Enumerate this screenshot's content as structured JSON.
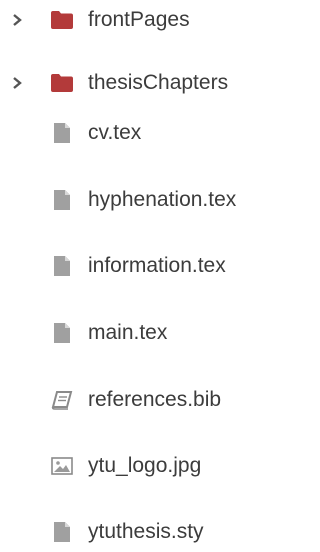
{
  "file_tree": {
    "items": [
      {
        "type": "folder",
        "label": "frontPages",
        "icon": "folder-icon",
        "expanded": false
      },
      {
        "type": "folder",
        "label": "thesisChapters",
        "icon": "folder-icon",
        "expanded": false
      },
      {
        "type": "file",
        "label": "cv.tex",
        "icon": "file-icon"
      },
      {
        "type": "file",
        "label": "hyphenation.tex",
        "icon": "file-icon"
      },
      {
        "type": "file",
        "label": "information.tex",
        "icon": "file-icon"
      },
      {
        "type": "file",
        "label": "main.tex",
        "icon": "file-icon"
      },
      {
        "type": "file",
        "label": "references.bib",
        "icon": "book-icon"
      },
      {
        "type": "file",
        "label": "ytu_logo.jpg",
        "icon": "image-icon"
      },
      {
        "type": "file",
        "label": "ytuthesis.sty",
        "icon": "file-icon"
      }
    ]
  },
  "colors": {
    "folder": "#b33a3a",
    "file_icon": "#a0a0a0",
    "caret": "#555555",
    "text": "#3c3c3c"
  }
}
